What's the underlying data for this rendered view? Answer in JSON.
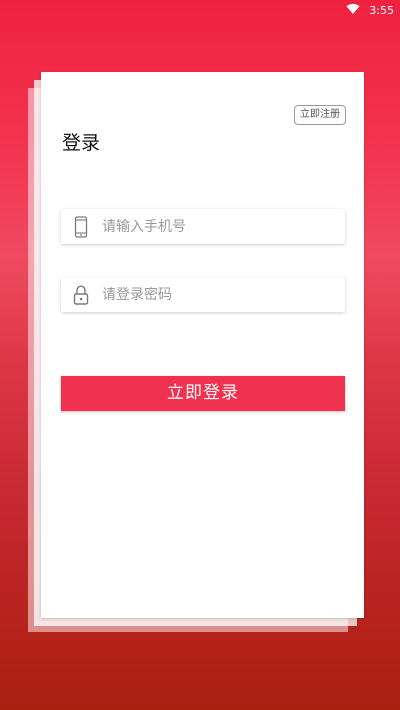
{
  "status_bar": {
    "time": "3:55",
    "wifi_icon": "wifi-icon"
  },
  "card": {
    "register_label": "立即注册",
    "title": "登录",
    "phone_field": {
      "icon": "phone-icon",
      "placeholder": "请输入手机号",
      "value": ""
    },
    "password_field": {
      "icon": "lock-icon",
      "placeholder": "请登录密码",
      "value": ""
    },
    "login_label": "立即登录"
  },
  "colors": {
    "accent": "#f0314f",
    "background_top": "#ee2240",
    "background_bottom": "#a92010"
  }
}
